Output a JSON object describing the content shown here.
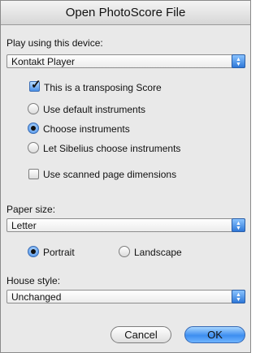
{
  "window": {
    "title": "Open PhotoScore File"
  },
  "device": {
    "label": "Play using this device:",
    "selected": "Kontakt Player"
  },
  "transposing": {
    "label": "This is a transposing Score",
    "checked": true
  },
  "instruments": {
    "options": [
      {
        "label": "Use default instruments",
        "selected": false
      },
      {
        "label": "Choose instruments",
        "selected": true
      },
      {
        "label": "Let Sibelius choose instruments",
        "selected": false
      }
    ]
  },
  "scanned": {
    "label": "Use scanned page dimensions",
    "checked": false
  },
  "paper": {
    "label": "Paper size:",
    "selected": "Letter",
    "orientation": [
      {
        "label": "Portrait",
        "selected": true
      },
      {
        "label": "Landscape",
        "selected": false
      }
    ]
  },
  "house_style": {
    "label": "House style:",
    "selected": "Unchanged"
  },
  "buttons": {
    "cancel": "Cancel",
    "ok": "OK"
  },
  "colors": {
    "accent": "#3d8ef0",
    "window_bg": "#e9e9e9"
  }
}
